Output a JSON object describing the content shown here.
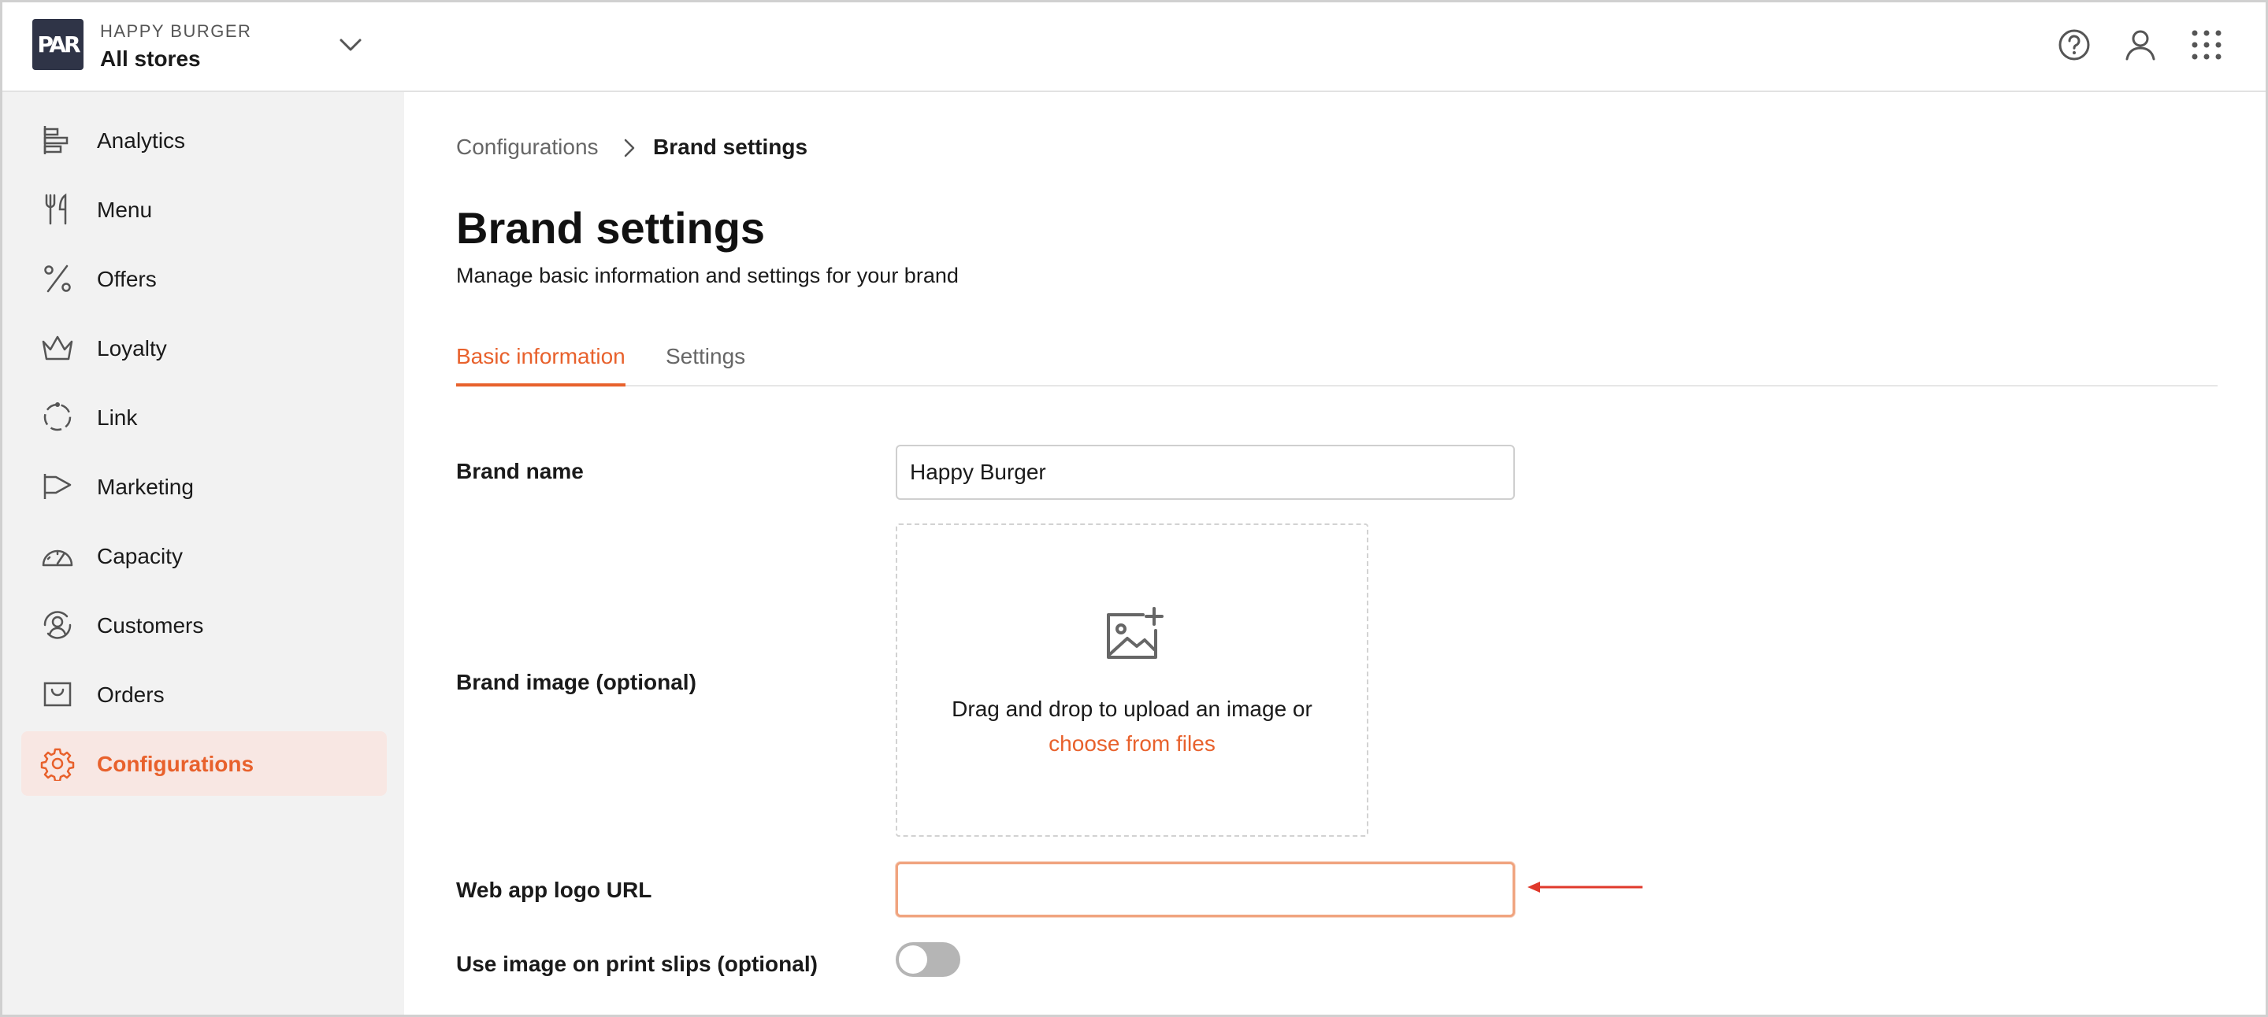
{
  "header": {
    "logo_text": "PAR",
    "brand_name": "HAPPY BURGER",
    "store_selector": "All stores",
    "icons": [
      "help-icon",
      "user-icon",
      "apps-grid-icon"
    ]
  },
  "sidebar": {
    "items": [
      {
        "label": "Analytics",
        "icon": "analytics-icon",
        "active": false
      },
      {
        "label": "Menu",
        "icon": "fork-knife-icon",
        "active": false
      },
      {
        "label": "Offers",
        "icon": "percent-icon",
        "active": false
      },
      {
        "label": "Loyalty",
        "icon": "crown-icon",
        "active": false
      },
      {
        "label": "Link",
        "icon": "link-circle-icon",
        "active": false
      },
      {
        "label": "Marketing",
        "icon": "megaphone-icon",
        "active": false
      },
      {
        "label": "Capacity",
        "icon": "gauge-icon",
        "active": false
      },
      {
        "label": "Customers",
        "icon": "customers-icon",
        "active": false
      },
      {
        "label": "Orders",
        "icon": "orders-icon",
        "active": false
      },
      {
        "label": "Configurations",
        "icon": "gear-icon",
        "active": true
      }
    ]
  },
  "breadcrumb": {
    "parent": "Configurations",
    "current": "Brand settings"
  },
  "page": {
    "title": "Brand settings",
    "subtitle": "Manage basic information and settings for your brand"
  },
  "tabs": {
    "basic": "Basic information",
    "settings": "Settings",
    "active": "basic"
  },
  "form": {
    "brand_name_label": "Brand name",
    "brand_name_value": "Happy Burger",
    "brand_image_label": "Brand image (optional)",
    "dropzone_text": "Drag and drop to upload an image or",
    "dropzone_link": "choose from files",
    "logo_url_label": "Web app logo URL",
    "logo_url_value": "",
    "print_slips_label": "Use image on print slips (optional)",
    "print_slips_enabled": false
  },
  "colors": {
    "accent": "#e8612c",
    "active_bg": "#f8e7e3",
    "sidebar_bg": "#f2f2f2",
    "logo_bg": "#2f3447",
    "arrow": "#e0392b"
  }
}
